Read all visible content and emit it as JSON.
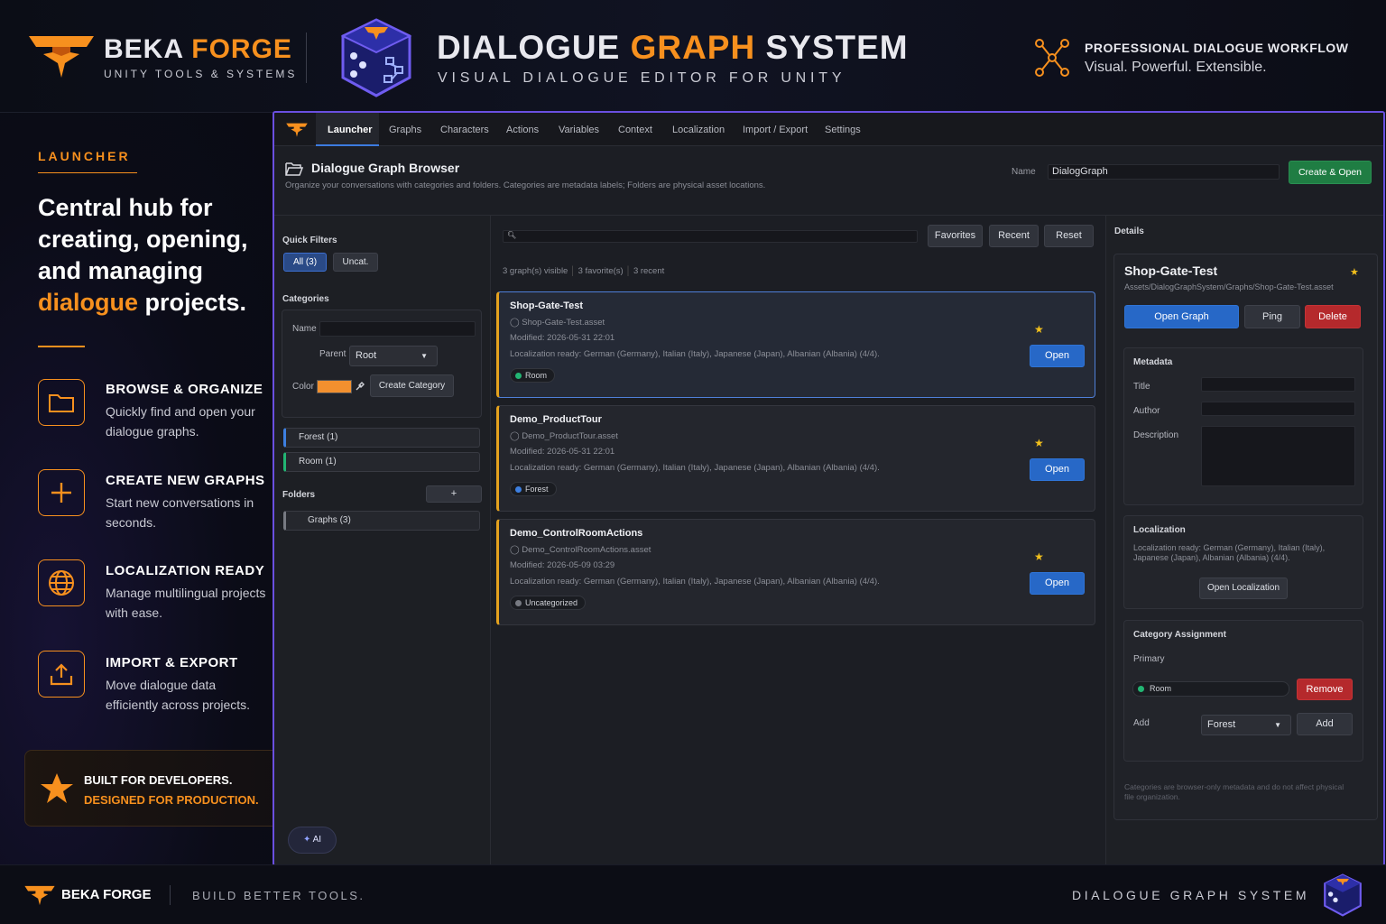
{
  "brand": {
    "name_a": "BEKA",
    "name_b": "FORGE",
    "tagline": "UNITY TOOLS & SYSTEMS"
  },
  "product": {
    "title_a": "DIALOGUE",
    "title_b": "GRAPH",
    "title_c": "SYSTEM",
    "subtitle": "VISUAL DIALOGUE EDITOR FOR UNITY"
  },
  "header_right": {
    "line1": "PROFESSIONAL DIALOGUE WORKFLOW",
    "line2": "Visual. Powerful. Extensible."
  },
  "left": {
    "section": "LAUNCHER",
    "headline_1": "Central hub for",
    "headline_2": "creating, opening,",
    "headline_3": "and managing",
    "headline_hl": "dialogue",
    "headline_4": " projects.",
    "features": [
      {
        "title": "BROWSE & ORGANIZE",
        "desc": "Quickly find and open your dialogue graphs.",
        "icon": "folder-icon"
      },
      {
        "title": "CREATE NEW GRAPHS",
        "desc": "Start new conversations in seconds.",
        "icon": "plus-icon"
      },
      {
        "title": "LOCALIZATION READY",
        "desc": "Manage multilingual projects with ease.",
        "icon": "globe-icon"
      },
      {
        "title": "IMPORT & EXPORT",
        "desc": "Move dialogue data efficiently across projects.",
        "icon": "upload-icon"
      }
    ],
    "banner_1": "BUILT FOR DEVELOPERS.",
    "banner_2": "DESIGNED FOR PRODUCTION."
  },
  "footer": {
    "brand": "BEKA FORGE",
    "slogan": "BUILD BETTER TOOLS.",
    "product": "DIALOGUE GRAPH SYSTEM"
  },
  "tabs": [
    "Launcher",
    "Graphs",
    "Characters",
    "Actions",
    "Variables",
    "Context",
    "Localization",
    "Import / Export",
    "Settings"
  ],
  "browser": {
    "title": "Dialogue Graph Browser",
    "desc": "Organize your conversations with categories and folders. Categories are metadata labels; Folders are physical asset locations.",
    "name_label": "Name",
    "name_value": "DialogGraph",
    "create_open": "Create & Open"
  },
  "filters": {
    "label": "Quick Filters",
    "all": "All (3)",
    "uncat": "Uncat."
  },
  "categories": {
    "label": "Categories",
    "name_label": "Name",
    "parent_label": "Parent",
    "parent_value": "Root",
    "color_label": "Color",
    "color_value": "#f2902f",
    "create_btn": "Create Category",
    "items": [
      {
        "label": "Forest (1)",
        "color": "#3d7fe0"
      },
      {
        "label": "Room (1)",
        "color": "#22b573"
      }
    ]
  },
  "folders": {
    "label": "Folders",
    "add": "+",
    "items": [
      "Graphs (3)"
    ]
  },
  "search": {
    "placeholder": "",
    "favorites": "Favorites",
    "recent": "Recent",
    "reset": "Reset"
  },
  "stats": {
    "visible": "3 graph(s) visible",
    "favs": "3 favorite(s)",
    "recent": "3 recent"
  },
  "graphs": [
    {
      "name": "Shop-Gate-Test",
      "file": "Shop-Gate-Test.asset",
      "modified": "Modified: 2026-05-31 22:01",
      "loc": "Localization ready: German (Germany), Italian (Italy), Japanese (Japan), Albanian (Albania) (4/4).",
      "tag": "Room",
      "tag_color": "#22b573",
      "open": "Open",
      "fav": "★"
    },
    {
      "name": "Demo_ProductTour",
      "file": "Demo_ProductTour.asset",
      "modified": "Modified: 2026-05-31 22:01",
      "loc": "Localization ready: German (Germany), Italian (Italy), Japanese (Japan), Albanian (Albania) (4/4).",
      "tag": "Forest",
      "tag_color": "#3d7fe0",
      "open": "Open",
      "fav": "★"
    },
    {
      "name": "Demo_ControlRoomActions",
      "file": "Demo_ControlRoomActions.asset",
      "modified": "Modified: 2026-05-09 03:29",
      "loc": "Localization ready: German (Germany), Italian (Italy), Japanese (Japan), Albanian (Albania) (4/4).",
      "tag": "Uncategorized",
      "tag_color": "#777a82",
      "open": "Open",
      "fav": "★"
    }
  ],
  "details": {
    "label": "Details",
    "name": "Shop-Gate-Test",
    "path": "Assets/DialogGraphSystem/Graphs/Shop-Gate-Test.asset",
    "fav": "★",
    "open_graph": "Open Graph",
    "ping": "Ping",
    "delete": "Delete",
    "metadata": "Metadata",
    "title_label": "Title",
    "author_label": "Author",
    "desc_label": "Description",
    "localization": "Localization",
    "loc_text": "Localization ready: German (Germany), Italian (Italy), Japanese (Japan), Albanian (Albania) (4/4).",
    "open_loc": "Open Localization",
    "cat_assign": "Category Assignment",
    "primary": "Primary",
    "primary_value": "Room",
    "remove": "Remove",
    "add_label": "Add",
    "add_value": "Forest",
    "add_btn": "Add",
    "note": "Categories are browser-only metadata and do not affect physical file organization."
  },
  "ai": "AI"
}
